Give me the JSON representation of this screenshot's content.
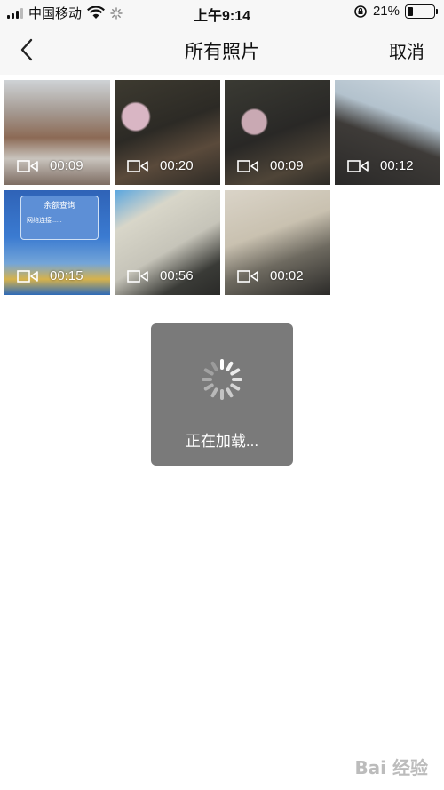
{
  "status_bar": {
    "carrier": "中国移动",
    "time": "上午9:14",
    "battery_percent": "21%",
    "battery_level": 0.21
  },
  "nav": {
    "title": "所有照片",
    "cancel_label": "取消"
  },
  "videos": [
    {
      "duration": "00:09"
    },
    {
      "duration": "00:20"
    },
    {
      "duration": "00:09"
    },
    {
      "duration": "00:12"
    },
    {
      "duration": "00:15"
    },
    {
      "duration": "00:56"
    },
    {
      "duration": "00:02"
    }
  ],
  "thumb_texts": {
    "dialog_title": "余额查询",
    "dialog_msg": "网络连接......"
  },
  "loading": {
    "text": "正在加载..."
  },
  "watermark": {
    "text": "Bai 经验"
  },
  "colors": {
    "bar_bg": "#f7f7f7",
    "loading_bg": "#7a7a7a"
  }
}
